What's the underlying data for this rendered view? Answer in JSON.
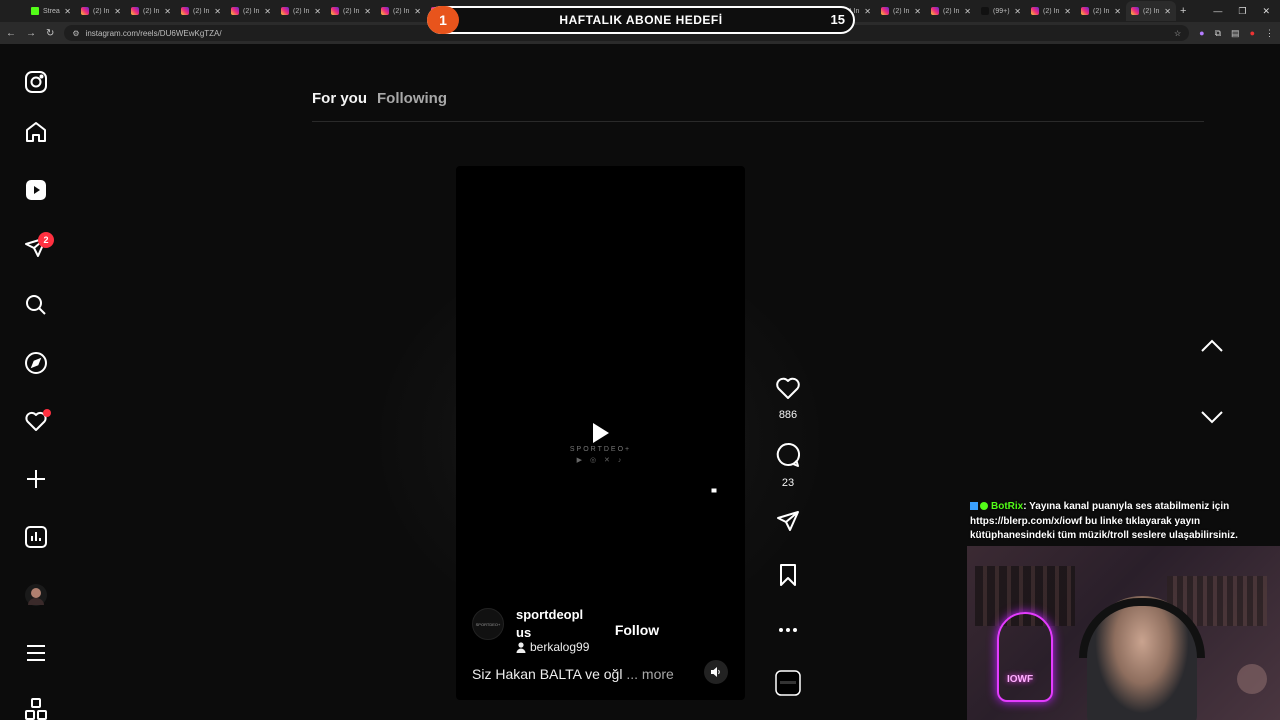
{
  "browser": {
    "tabs": [
      {
        "label": "Strea",
        "favicon": "kick"
      },
      {
        "label": "(2) In",
        "favicon": "instagram"
      },
      {
        "label": "(2) In",
        "favicon": "instagram"
      },
      {
        "label": "(2) In",
        "favicon": "instagram"
      },
      {
        "label": "(2) In",
        "favicon": "instagram"
      },
      {
        "label": "(2) In",
        "favicon": "instagram"
      },
      {
        "label": "(2) In",
        "favicon": "instagram"
      },
      {
        "label": "(2) In",
        "favicon": "instagram"
      },
      {
        "label": "(2) In",
        "favicon": "instagram"
      },
      {
        "label": "(2) In",
        "favicon": "instagram"
      },
      {
        "label": "(2) In",
        "favicon": "instagram"
      },
      {
        "label": "(2) In",
        "favicon": "instagram"
      },
      {
        "label": "(2) In",
        "favicon": "instagram"
      },
      {
        "label": "(2) In",
        "favicon": "instagram"
      },
      {
        "label": "(2) In",
        "favicon": "instagram"
      },
      {
        "label": "(2) In",
        "favicon": "instagram"
      },
      {
        "label": "(2) In",
        "favicon": "instagram"
      },
      {
        "label": "(2) In",
        "favicon": "instagram"
      },
      {
        "label": "(2) In",
        "favicon": "instagram"
      },
      {
        "label": "(99+)",
        "favicon": "tiktok"
      },
      {
        "label": "(2) In",
        "favicon": "instagram"
      },
      {
        "label": "(2) In",
        "favicon": "instagram"
      },
      {
        "label": "(2) In",
        "favicon": "instagram",
        "active": true
      }
    ],
    "url": "instagram.com/reels/DU6WEwKgTZA/"
  },
  "overlay_goal": {
    "level": "1",
    "title": "HAFTALIK ABONE HEDEFİ",
    "count": "15",
    "accent": "#e8541c"
  },
  "sidebar": {
    "items": [
      {
        "name": "instagram-logo-icon"
      },
      {
        "name": "home-icon"
      },
      {
        "name": "reels-icon"
      },
      {
        "name": "messages-icon",
        "badge": "2"
      },
      {
        "name": "search-icon"
      },
      {
        "name": "explore-icon"
      },
      {
        "name": "notifications-icon"
      },
      {
        "name": "create-icon"
      },
      {
        "name": "dashboard-icon"
      },
      {
        "name": "profile-avatar"
      },
      {
        "name": "more-menu-icon"
      },
      {
        "name": "also-from-meta-icon"
      }
    ]
  },
  "feed_tabs": {
    "for_you": "For you",
    "following": "Following"
  },
  "reel": {
    "watermark": "SPORTDEO+",
    "author": "sportdeoplus",
    "author_line1": "sportdeopl",
    "author_line2": "us",
    "avatar_text": "SPORTDEO+",
    "follow_label": "Follow",
    "audio_user": "berkalog99",
    "caption": "Siz Hakan BALTA ve oğl",
    "more_label": "... more"
  },
  "actions": {
    "likes": "886",
    "comments": "23"
  },
  "chat": {
    "user": "BotRix",
    "message": ": Yayına kanal puanıyla ses atabilmeniz için https://blerp.com/x/iowf bu linke tıklayarak yayın kütüphanesindeki tüm müzik/troll seslere ulaşabilirsiniz."
  },
  "webcam": {
    "neon_text": "IOWF"
  }
}
